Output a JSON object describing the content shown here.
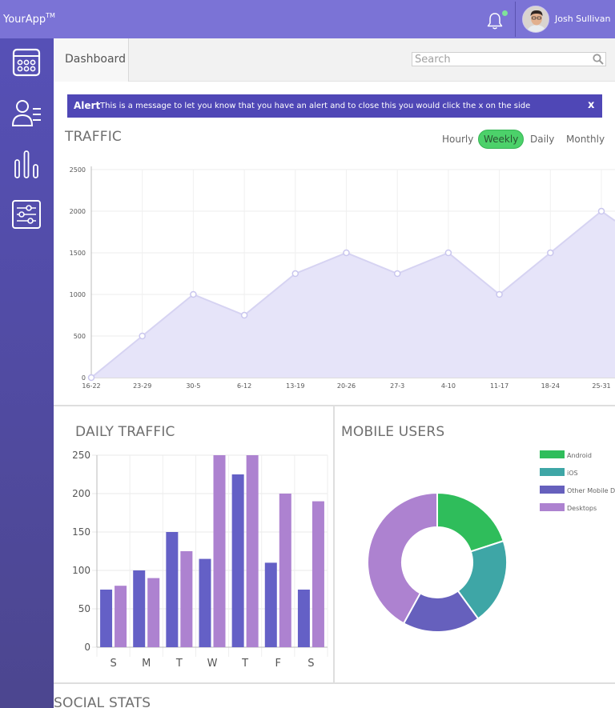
{
  "header": {
    "logo": "YourApp",
    "logo_tm": "TM",
    "user_name": "Josh Sullivan"
  },
  "topbar": {
    "tab": "Dashboard",
    "search_placeholder": "Search"
  },
  "alert": {
    "title": "Alert",
    "message": "This is a message to let you know that you have an alert and to close this you would click the x on the side",
    "close": "x"
  },
  "traffic": {
    "title": "TRAFFIC",
    "periods": [
      "Hourly",
      "Weekly",
      "Daily",
      "Monthly"
    ],
    "active_period": "Weekly"
  },
  "daily_traffic": {
    "title": "DAILY TRAFFIC"
  },
  "mobile_users": {
    "title": "MOBILE USERS"
  },
  "social_stats": {
    "title": "SOCIAL STATS"
  },
  "colors": {
    "accent": "#7b73d6",
    "sidebar": "#5650b6",
    "alert": "#4f47b6",
    "green": "#4cd16a"
  },
  "chart_data": [
    {
      "type": "area",
      "categories": [
        "16-22",
        "23-29",
        "30-5",
        "6-12",
        "13-19",
        "20-26",
        "27-3",
        "4-10",
        "11-17",
        "18-24",
        "25-31"
      ],
      "values": [
        0,
        500,
        1000,
        750,
        1250,
        1500,
        1250,
        1500,
        1000,
        1500,
        2000
      ],
      "yticks": [
        0,
        500,
        1000,
        1500,
        2000,
        2500
      ],
      "ylim": [
        0,
        2500
      ],
      "grid": true,
      "color": "#e6e4f9"
    },
    {
      "type": "bar",
      "categories": [
        "S",
        "M",
        "T",
        "W",
        "T",
        "F",
        "S"
      ],
      "series": [
        {
          "values": [
            75,
            100,
            150,
            115,
            225,
            110,
            75
          ],
          "color": "#6460c6"
        },
        {
          "values": [
            80,
            90,
            125,
            250,
            250,
            200,
            190
          ],
          "color": "#ad82d0"
        }
      ],
      "yticks": [
        0,
        50,
        100,
        150,
        200,
        250
      ],
      "ylim": [
        0,
        250
      ],
      "grid": true
    },
    {
      "type": "pie",
      "labels": [
        "Android",
        "iOS",
        "Other Mobile Devices",
        "Desktops"
      ],
      "values": [
        20,
        20,
        18,
        42
      ],
      "colors": [
        "#2fbd5b",
        "#3ea6a6",
        "#6660bd",
        "#ad82d0"
      ],
      "legend": "right"
    }
  ]
}
